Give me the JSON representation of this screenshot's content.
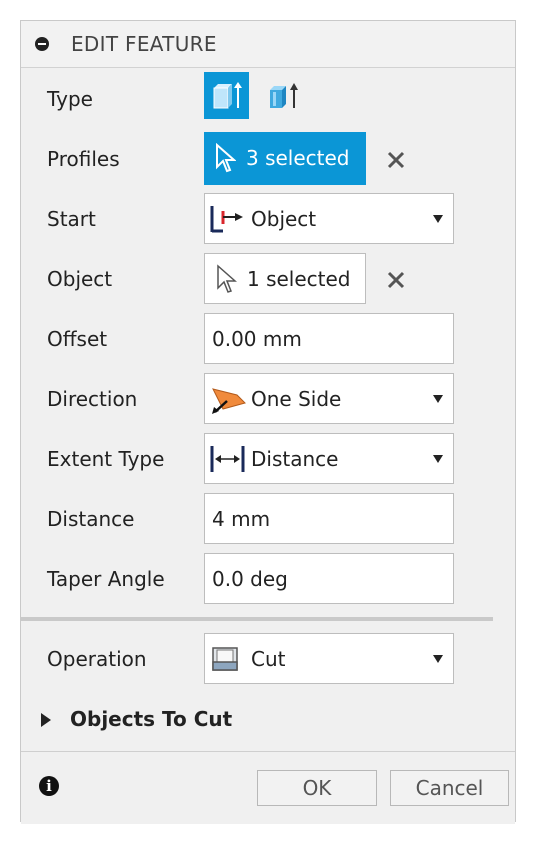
{
  "header": {
    "title": "EDIT FEATURE"
  },
  "rows": {
    "type": {
      "label": "Type"
    },
    "profiles": {
      "label": "Profiles",
      "value": "3 selected"
    },
    "start": {
      "label": "Start",
      "value": "Object"
    },
    "object": {
      "label": "Object",
      "value": "1 selected"
    },
    "offset": {
      "label": "Offset",
      "value": "0.00 mm"
    },
    "direction": {
      "label": "Direction",
      "value": "One Side"
    },
    "extent_type": {
      "label": "Extent Type",
      "value": "Distance"
    },
    "distance": {
      "label": "Distance",
      "value": "4 mm"
    },
    "taper_angle": {
      "label": "Taper Angle",
      "value": "0.0 deg"
    },
    "operation": {
      "label": "Operation",
      "value": "Cut"
    }
  },
  "section": {
    "objects_to_cut": "Objects To Cut"
  },
  "footer": {
    "ok_label": "OK",
    "cancel_label": "Cancel"
  },
  "colors": {
    "accent": "#0b96d6",
    "direction_icon": "#f08a3c",
    "start_marker": "#d9262c"
  },
  "icons": {
    "collapse": "minus-circle-icon",
    "type_solid": "extrude-solid-icon",
    "type_thin": "extrude-thin-icon",
    "cursor": "cursor-arrow-icon",
    "clear": "close-icon",
    "start": "start-object-icon",
    "direction": "one-side-direction-icon",
    "extent": "distance-icon",
    "operation": "cut-operation-icon",
    "info": "info-icon",
    "expand": "triangle-right-icon"
  }
}
